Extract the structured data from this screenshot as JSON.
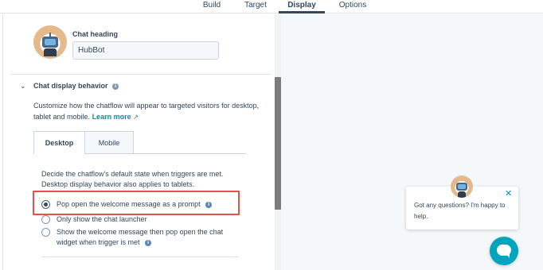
{
  "top_tabs": [
    {
      "label": "Build",
      "active": false
    },
    {
      "label": "Target",
      "active": false
    },
    {
      "label": "Display",
      "active": true
    },
    {
      "label": "Options",
      "active": false
    }
  ],
  "chat_heading": {
    "label": "Chat heading",
    "value": "HubBot",
    "avatar_icon": "robot-avatar-icon"
  },
  "display_behavior": {
    "title": "Chat display behavior",
    "description": "Customize how the chatflow will appear to targeted visitors for desktop, tablet and mobile.",
    "learn_more": "Learn more",
    "tabs": [
      {
        "label": "Desktop",
        "active": true
      },
      {
        "label": "Mobile",
        "active": false
      }
    ],
    "tab_description_1": "Decide the chatflow's default state when triggers are met.",
    "tab_description_2": "Desktop display behavior also applies to tablets.",
    "options": [
      {
        "label": "Pop open the welcome message as a prompt",
        "checked": true
      },
      {
        "label": "Only show the chat launcher",
        "checked": false
      },
      {
        "label_line1": "Show the welcome message then pop open the chat",
        "label_line2": "widget when trigger is met",
        "checked": false
      }
    ]
  },
  "preview": {
    "welcome_message_line1": "Got any questions? I'm happy to",
    "welcome_message_line2": "help.",
    "close_icon": "close-icon",
    "launcher_icon": "chat-bubble-icon"
  },
  "colors": {
    "accent": "#00a4bd",
    "link": "#0091ae",
    "highlight": "#e8504f",
    "text": "#33475b"
  }
}
